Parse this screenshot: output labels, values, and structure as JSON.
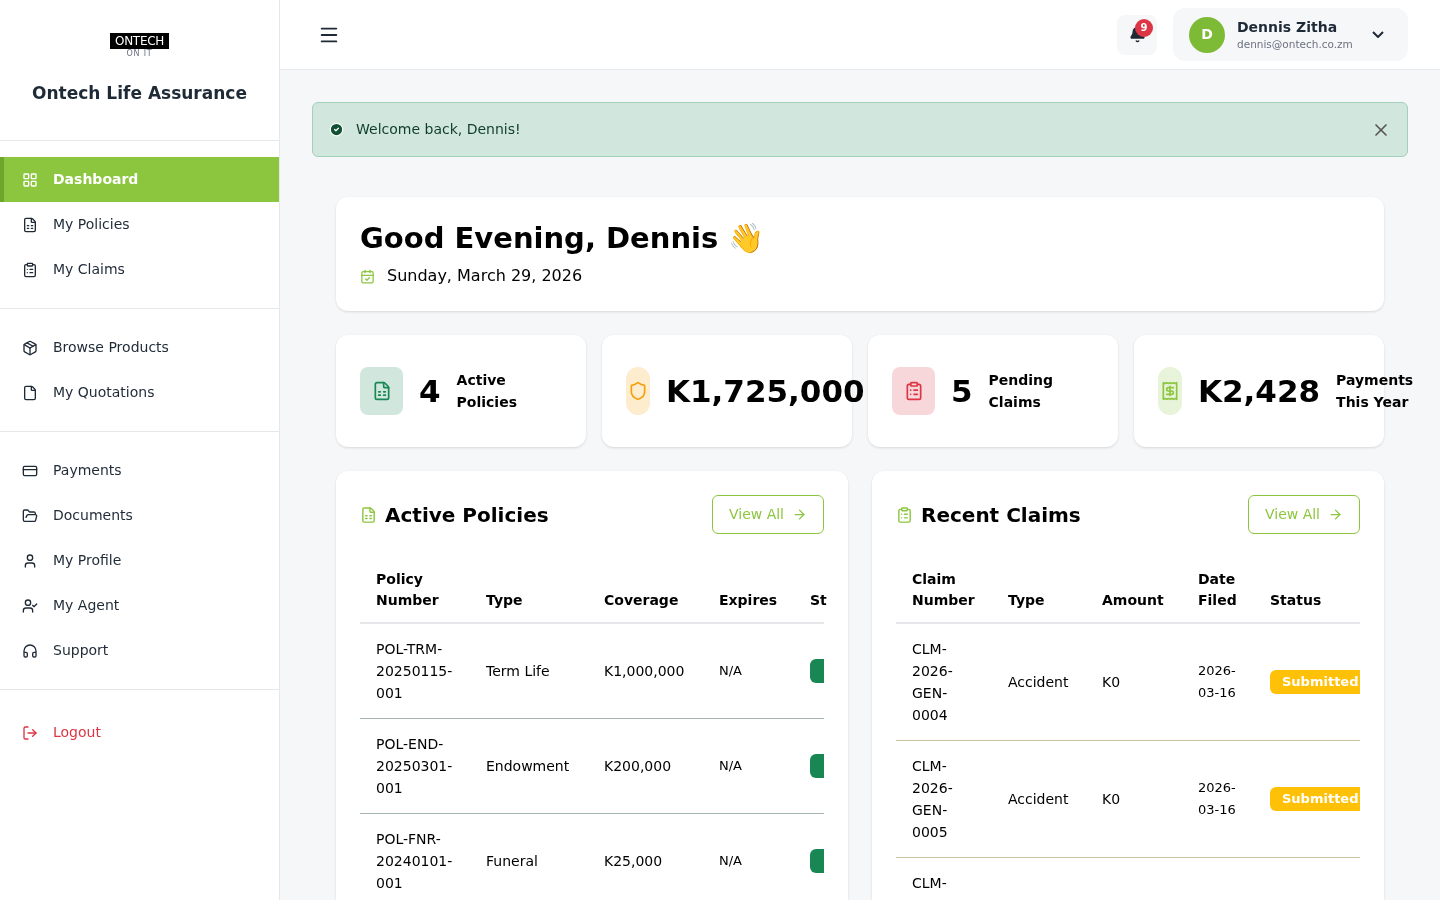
{
  "brand": {
    "logo": "ONTECH",
    "tagline": "ON IT",
    "name": "Ontech Life Assurance"
  },
  "sidebar": {
    "groups": [
      [
        {
          "label": "Dashboard",
          "selected": true
        },
        {
          "label": "My Policies",
          "selected": false
        },
        {
          "label": "My Claims",
          "selected": false
        }
      ],
      [
        {
          "label": "Browse Products",
          "selected": false
        },
        {
          "label": "My Quotations",
          "selected": false
        }
      ],
      [
        {
          "label": "Payments",
          "selected": false
        },
        {
          "label": "Documents",
          "selected": false
        },
        {
          "label": "My Profile",
          "selected": false
        },
        {
          "label": "My Agent",
          "selected": false
        },
        {
          "label": "Support",
          "selected": false
        }
      ],
      [
        {
          "label": "Logout",
          "selected": false,
          "kind": "danger"
        }
      ]
    ]
  },
  "header": {
    "notifications": "9",
    "user": {
      "initial": "D",
      "name": "Dennis Zitha",
      "email": "dennis@ontech.co.zm"
    }
  },
  "alert": {
    "message": "Welcome back, Dennis!"
  },
  "greeting": {
    "title": "Good Evening, Dennis 👋",
    "date": "Sunday, March 29, 2026"
  },
  "stats": [
    {
      "value": "4",
      "label": "Active Policies",
      "color": "#198754"
    },
    {
      "value": "K1,725,000",
      "color": "#f59f0b"
    },
    {
      "value": "5",
      "label": "Pending Claims",
      "color": "#dc3545"
    },
    {
      "value": "K2,428",
      "label": "Payments This Year",
      "color": "#8cc63f"
    }
  ],
  "policies": {
    "title": "Active Policies",
    "button": "View All",
    "columns": [
      "Policy Number",
      "Type",
      "Coverage",
      "Expires",
      "St"
    ],
    "rows": [
      {
        "number": "POL-TRM-20250115-001",
        "type": "Term Life",
        "coverage": "K1,000,000",
        "expires": "N/A",
        "color": "#198754"
      },
      {
        "number": "POL-END-20250301-001",
        "type": "Endowment",
        "coverage": "K200,000",
        "expires": "N/A",
        "color": "#198754"
      },
      {
        "number": "POL-FNR-20240101-001",
        "type": "Funeral",
        "coverage": "K25,000",
        "expires": "N/A",
        "color": "#198754"
      }
    ]
  },
  "claims": {
    "title": "Recent Claims",
    "button": "View All",
    "columns": [
      "Claim Number",
      "Type",
      "Amount",
      "Date Filed",
      "Status"
    ],
    "rows": [
      {
        "number": "CLM-2026-GEN-0004",
        "type": "Accident",
        "amount": "K0",
        "date": "2026-03-16",
        "status": "Submitted",
        "color": "#ffc107"
      },
      {
        "number": "CLM-2026-GEN-0005",
        "type": "Accident",
        "amount": "K0",
        "date": "2026-03-16",
        "status": "Submitted",
        "color": "#ffc107"
      },
      {
        "number": "CLM-"
      }
    ]
  }
}
